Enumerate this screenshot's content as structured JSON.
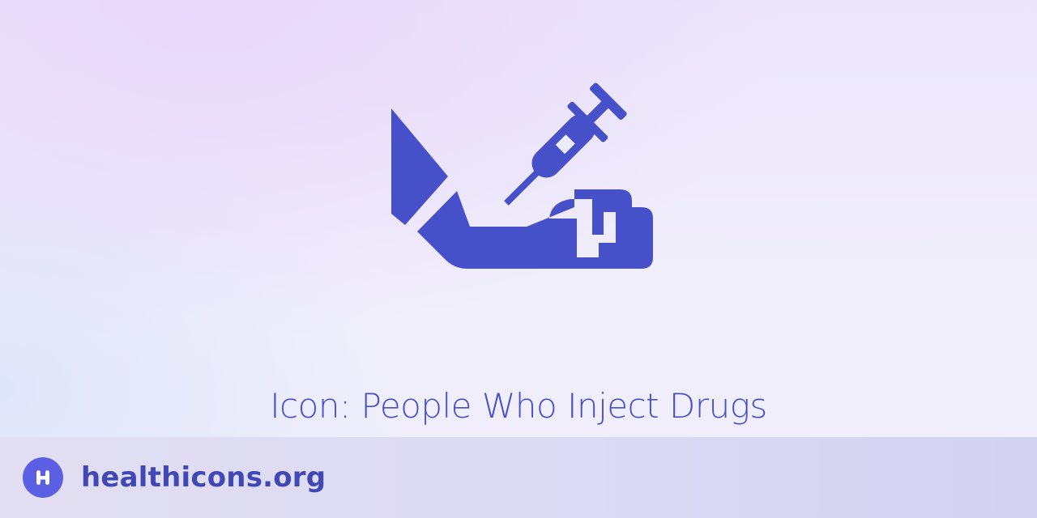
{
  "hero": {
    "icon": "people-who-inject-drugs-icon",
    "title": "Icon: People Who Inject Drugs"
  },
  "footer": {
    "logo_icon": "healthicons-h-logo-icon",
    "site_name": "healthicons.org"
  },
  "colors": {
    "icon": "#4650c9",
    "title": "#4650c9",
    "brand_badge": "#5a5fe3",
    "brand_text": "#3f48b5",
    "footer_bar": "#dcdaf3"
  }
}
